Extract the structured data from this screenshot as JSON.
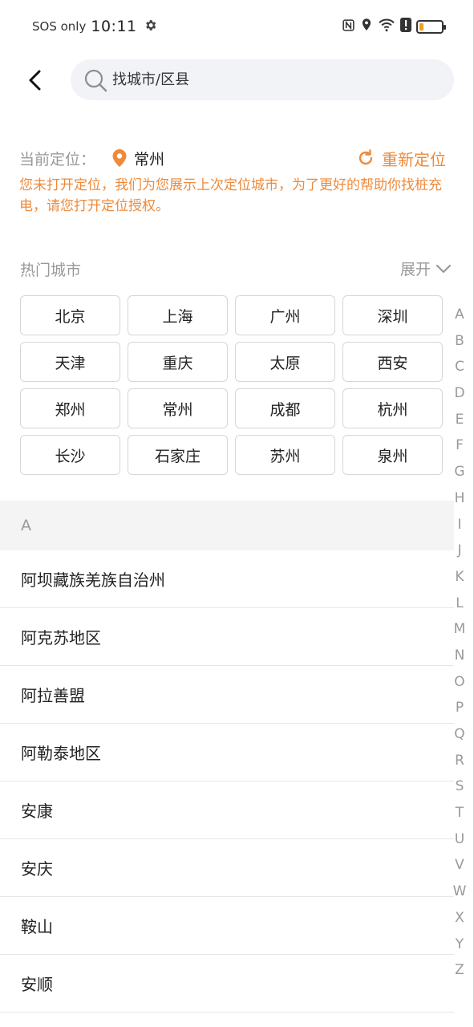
{
  "status_bar": {
    "carrier": "SOS only",
    "time": "10:11"
  },
  "search": {
    "placeholder": "找城市/区县"
  },
  "location": {
    "label": "当前定位：",
    "city": "常州",
    "relocate_label": "重新定位",
    "notice": "您未打开定位，我们为您展示上次定位城市，为了更好的帮助你找桩充电，请您打开定位授权。"
  },
  "hot_cities": {
    "title": "热门城市",
    "expand_label": "展开",
    "items": [
      "北京",
      "上海",
      "广州",
      "深圳",
      "天津",
      "重庆",
      "太原",
      "西安",
      "郑州",
      "常州",
      "成都",
      "杭州",
      "长沙",
      "石家庄",
      "苏州",
      "泉州"
    ]
  },
  "section": {
    "letter": "A",
    "cities": [
      "阿坝藏族羌族自治州",
      "阿克苏地区",
      "阿拉善盟",
      "阿勒泰地区",
      "安康",
      "安庆",
      "鞍山",
      "安顺"
    ]
  },
  "alpha_index": [
    "A",
    "B",
    "C",
    "D",
    "E",
    "F",
    "G",
    "H",
    "I",
    "J",
    "K",
    "L",
    "M",
    "N",
    "O",
    "P",
    "Q",
    "R",
    "S",
    "T",
    "U",
    "V",
    "W",
    "X",
    "Y",
    "Z"
  ],
  "colors": {
    "accent": "#ee8a3b",
    "muted_text": "#999999",
    "section_bg": "#f4f4f4"
  },
  "icons": {
    "settings": "gear-icon",
    "nfc": "nfc-icon",
    "location_status": "location-status-icon",
    "wifi": "wifi-icon",
    "alert": "alert-icon",
    "battery": "battery-icon",
    "back": "back-arrow-icon",
    "search": "search-icon",
    "pin": "location-pin-icon",
    "relocate": "refresh-icon",
    "expand": "chevron-down-icon"
  },
  "battery": {
    "level": 0.2
  }
}
